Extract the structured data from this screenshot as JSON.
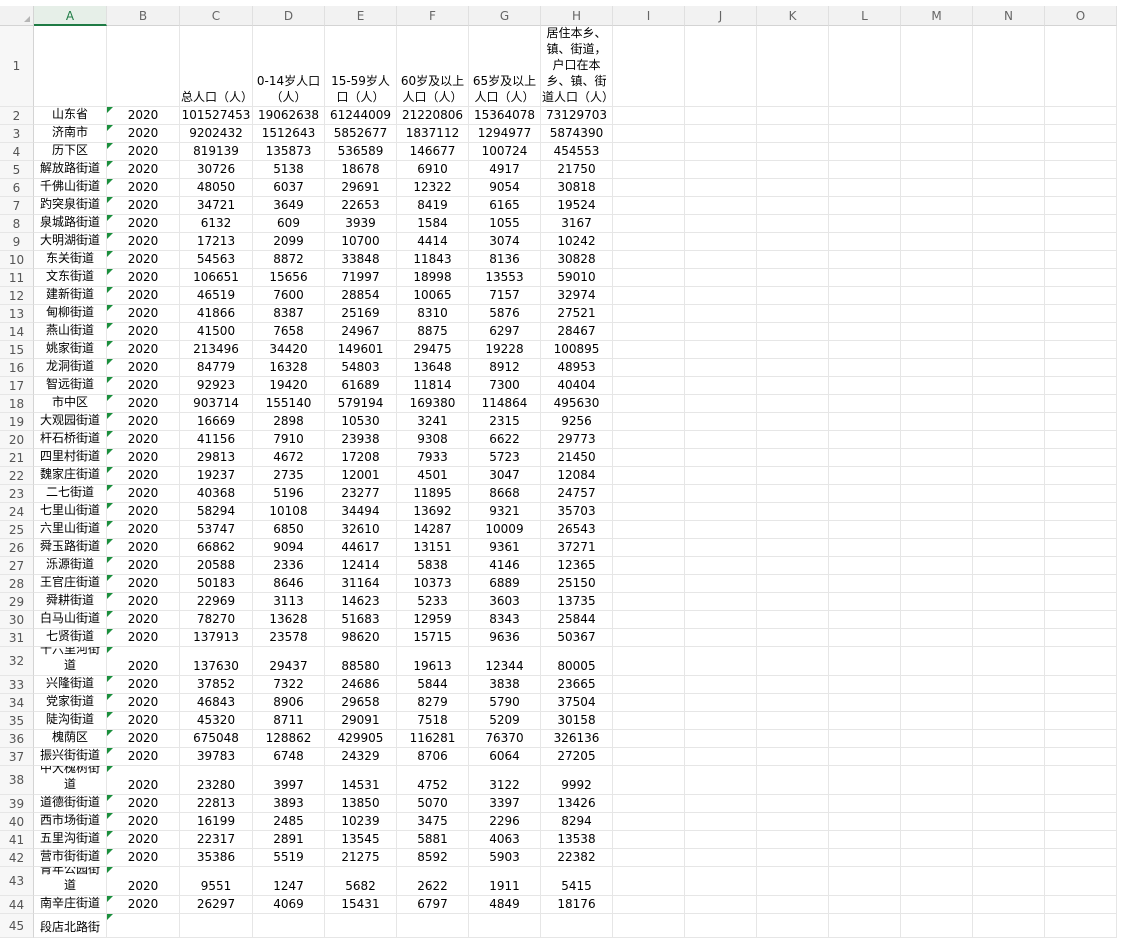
{
  "columns": [
    "A",
    "B",
    "C",
    "D",
    "E",
    "F",
    "G",
    "H",
    "I",
    "J",
    "K",
    "L",
    "M",
    "N",
    "O"
  ],
  "selected_column": "A",
  "header_row": [
    "",
    "",
    "总人口（人）",
    "0-14岁人口（人）",
    "15-59岁人口（人）",
    "60岁及以上人口（人）",
    "65岁及以上人口（人）",
    "居住本乡、镇、街道，户口在本乡、镇、街道人口（人）"
  ],
  "rows": [
    [
      "山东省",
      "2020",
      "101527453",
      "19062638",
      "61244009",
      "21220806",
      "15364078",
      "73129703"
    ],
    [
      "济南市",
      "2020",
      "9202432",
      "1512643",
      "5852677",
      "1837112",
      "1294977",
      "5874390"
    ],
    [
      "历下区",
      "2020",
      "819139",
      "135873",
      "536589",
      "146677",
      "100724",
      "454553"
    ],
    [
      "解放路街道",
      "2020",
      "30726",
      "5138",
      "18678",
      "6910",
      "4917",
      "21750"
    ],
    [
      "千佛山街道",
      "2020",
      "48050",
      "6037",
      "29691",
      "12322",
      "9054",
      "30818"
    ],
    [
      "趵突泉街道",
      "2020",
      "34721",
      "3649",
      "22653",
      "8419",
      "6165",
      "19524"
    ],
    [
      "泉城路街道",
      "2020",
      "6132",
      "609",
      "3939",
      "1584",
      "1055",
      "3167"
    ],
    [
      "大明湖街道",
      "2020",
      "17213",
      "2099",
      "10700",
      "4414",
      "3074",
      "10242"
    ],
    [
      "东关街道",
      "2020",
      "54563",
      "8872",
      "33848",
      "11843",
      "8136",
      "30828"
    ],
    [
      "文东街道",
      "2020",
      "106651",
      "15656",
      "71997",
      "18998",
      "13553",
      "59010"
    ],
    [
      "建新街道",
      "2020",
      "46519",
      "7600",
      "28854",
      "10065",
      "7157",
      "32974"
    ],
    [
      "甸柳街道",
      "2020",
      "41866",
      "8387",
      "25169",
      "8310",
      "5876",
      "27521"
    ],
    [
      "燕山街道",
      "2020",
      "41500",
      "7658",
      "24967",
      "8875",
      "6297",
      "28467"
    ],
    [
      "姚家街道",
      "2020",
      "213496",
      "34420",
      "149601",
      "29475",
      "19228",
      "100895"
    ],
    [
      "龙洞街道",
      "2020",
      "84779",
      "16328",
      "54803",
      "13648",
      "8912",
      "48953"
    ],
    [
      "智远街道",
      "2020",
      "92923",
      "19420",
      "61689",
      "11814",
      "7300",
      "40404"
    ],
    [
      "市中区",
      "2020",
      "903714",
      "155140",
      "579194",
      "169380",
      "114864",
      "495630"
    ],
    [
      "大观园街道",
      "2020",
      "16669",
      "2898",
      "10530",
      "3241",
      "2315",
      "9256"
    ],
    [
      "杆石桥街道",
      "2020",
      "41156",
      "7910",
      "23938",
      "9308",
      "6622",
      "29773"
    ],
    [
      "四里村街道",
      "2020",
      "29813",
      "4672",
      "17208",
      "7933",
      "5723",
      "21450"
    ],
    [
      "魏家庄街道",
      "2020",
      "19237",
      "2735",
      "12001",
      "4501",
      "3047",
      "12084"
    ],
    [
      "二七街道",
      "2020",
      "40368",
      "5196",
      "23277",
      "11895",
      "8668",
      "24757"
    ],
    [
      "七里山街道",
      "2020",
      "58294",
      "10108",
      "34494",
      "13692",
      "9321",
      "35703"
    ],
    [
      "六里山街道",
      "2020",
      "53747",
      "6850",
      "32610",
      "14287",
      "10009",
      "26543"
    ],
    [
      "舜玉路街道",
      "2020",
      "66862",
      "9094",
      "44617",
      "13151",
      "9361",
      "37271"
    ],
    [
      "泺源街道",
      "2020",
      "20588",
      "2336",
      "12414",
      "5838",
      "4146",
      "12365"
    ],
    [
      "王官庄街道",
      "2020",
      "50183",
      "8646",
      "31164",
      "10373",
      "6889",
      "25150"
    ],
    [
      "舜耕街道",
      "2020",
      "22969",
      "3113",
      "14623",
      "5233",
      "3603",
      "13735"
    ],
    [
      "白马山街道",
      "2020",
      "78270",
      "13628",
      "51683",
      "12959",
      "8343",
      "25844"
    ],
    [
      "七贤街道",
      "2020",
      "137913",
      "23578",
      "98620",
      "15715",
      "9636",
      "50367"
    ],
    [
      "十六里河街道",
      "2020",
      "137630",
      "29437",
      "88580",
      "19613",
      "12344",
      "80005"
    ],
    [
      "兴隆街道",
      "2020",
      "37852",
      "7322",
      "24686",
      "5844",
      "3838",
      "23665"
    ],
    [
      "党家街道",
      "2020",
      "46843",
      "8906",
      "29658",
      "8279",
      "5790",
      "37504"
    ],
    [
      "陡沟街道",
      "2020",
      "45320",
      "8711",
      "29091",
      "7518",
      "5209",
      "30158"
    ],
    [
      "槐荫区",
      "2020",
      "675048",
      "128862",
      "429905",
      "116281",
      "76370",
      "326136"
    ],
    [
      "振兴街街道",
      "2020",
      "39783",
      "6748",
      "24329",
      "8706",
      "6064",
      "27205"
    ],
    [
      "中大槐树街道",
      "2020",
      "23280",
      "3997",
      "14531",
      "4752",
      "3122",
      "9992"
    ],
    [
      "道德街街道",
      "2020",
      "22813",
      "3893",
      "13850",
      "5070",
      "3397",
      "13426"
    ],
    [
      "西市场街道",
      "2020",
      "16199",
      "2485",
      "10239",
      "3475",
      "2296",
      "8294"
    ],
    [
      "五里沟街道",
      "2020",
      "22317",
      "2891",
      "13545",
      "5881",
      "4063",
      "13538"
    ],
    [
      "营市街街道",
      "2020",
      "35386",
      "5519",
      "21275",
      "8592",
      "5903",
      "22382"
    ],
    [
      "青年公园街道",
      "2020",
      "9551",
      "1247",
      "5682",
      "2622",
      "1911",
      "5415"
    ],
    [
      "南辛庄街道",
      "2020",
      "26297",
      "4069",
      "15431",
      "6797",
      "4849",
      "18176"
    ],
    [
      "段店北路街",
      "",
      "",
      "",
      "",
      "",
      "",
      ""
    ]
  ],
  "row_numbers": [
    "1",
    "2",
    "3",
    "4",
    "5",
    "6",
    "7",
    "8",
    "9",
    "10",
    "11",
    "12",
    "13",
    "14",
    "15",
    "16",
    "17",
    "18",
    "19",
    "20",
    "21",
    "22",
    "23",
    "24",
    "25",
    "26",
    "27",
    "28",
    "29",
    "30",
    "31",
    "32",
    "33",
    "34",
    "35",
    "36",
    "37",
    "38",
    "39",
    "40",
    "41",
    "42",
    "43",
    "44",
    "45"
  ],
  "colors": {
    "selected_header": "#1e7b44",
    "text_flag": "#1a8f3c",
    "grid": "#e6e6e6"
  }
}
